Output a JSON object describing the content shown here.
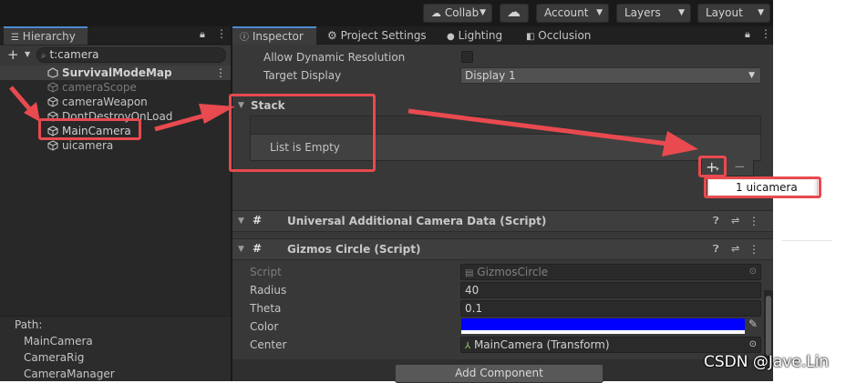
{
  "toolbar": {
    "collab": "Collab",
    "account": "Account",
    "layers": "Layers",
    "layout": "Layout"
  },
  "hierarchy": {
    "tab_label": "Hierarchy",
    "search_value": "t:camera",
    "scene": "SurvivalModeMap",
    "items": [
      "cameraScope",
      "cameraWeapon",
      "DontDestroyOnLoad",
      "MainCamera",
      "uicamera"
    ],
    "path_label": "Path:",
    "path_items": [
      "MainCamera",
      "CameraRig",
      "CameraManager"
    ]
  },
  "inspector": {
    "tabs": [
      "Inspector",
      "Project Settings",
      "Lighting",
      "Occlusion"
    ],
    "allow_dynamic_resolution": "Allow Dynamic Resolution",
    "target_display_label": "Target Display",
    "target_display_value": "Display 1",
    "stack_label": "Stack",
    "stack_empty": "List is Empty",
    "dropdown_item": "1 uicamera",
    "component1_title": "Universal Additional Camera Data (Script)",
    "component2_title": "Gizmos Circle (Script)",
    "fields": {
      "script_label": "Script",
      "script_value": "GizmosCircle",
      "radius_label": "Radius",
      "radius_value": "40",
      "theta_label": "Theta",
      "theta_value": "0.1",
      "color_label": "Color",
      "center_label": "Center",
      "center_value": "MainCamera (Transform)"
    },
    "add_component": "Add Component"
  },
  "watermark": "CSDN @Jave.Lin",
  "colors": {
    "annotation_red": "#e84a4f",
    "color_swatch": "#0000ff",
    "tab_accent": "#4a8ccf"
  }
}
